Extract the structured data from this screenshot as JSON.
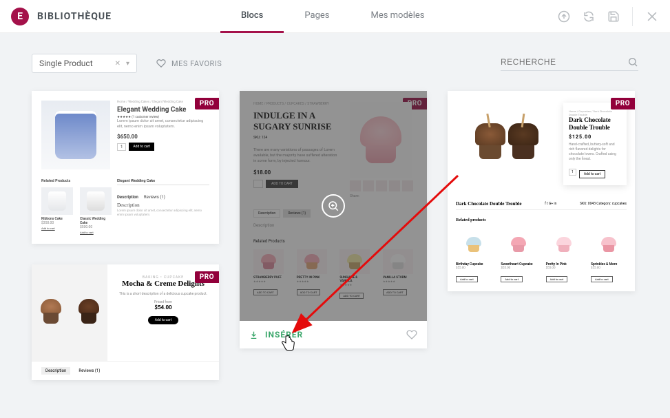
{
  "header": {
    "logo_glyph": "E",
    "title": "BIBLIOTHÈQUE",
    "tabs": {
      "blocs": "Blocs",
      "pages": "Pages",
      "models": "Mes modèles"
    }
  },
  "filter": {
    "select_value": "Single Product",
    "favorites": "MES FAVORIS",
    "search_placeholder": "RECHERCHE"
  },
  "badges": {
    "pro": "PRO"
  },
  "actions": {
    "insert": "INSÉRER"
  },
  "card1": {
    "crumb": "Home / Wedding Cakes / Elegant Wedding Cake",
    "title": "Elegant Wedding Cake",
    "rating_note": "★★★★★ (1 customer review)",
    "desc": "Lorem ipsum dolor sit amet, consectetur adipiscing elit, nemo enim ipsam voluptatem.",
    "price": "$650.00",
    "qty": "1",
    "add": "Add to cart",
    "related_h": "Related Products",
    "feat_title": "Elegant Wedding Cake",
    "r1": "Ribbons Cake",
    "r1p": "$350.00",
    "r2": "Classic Wedding Cake",
    "r2p": "$500.00",
    "rbtn": "Add to cart",
    "tab_desc": "Description",
    "tab_rev": "Reviews (1)",
    "desc_h": "Description"
  },
  "card_mocha": {
    "brand": "BAKING  •  CUPCAKE",
    "title": "Mocha & Creme Delights",
    "desc": "This is a short description of a delicious cupcake product.",
    "price_label": "Priced from",
    "price": "$54.00",
    "add": "Add to cart",
    "tab_desc": "Description",
    "tab_rev": "Reviews (1)"
  },
  "card2": {
    "crumb": "HOME / PRODUCTS / CUPCAKES / STRAWBERRY",
    "title": "INDULGE IN A SUGARY SUNRISE",
    "sku": "SKU: 124",
    "desc": "There are many variations of passages of Lorem available, but the majority have suffered alteration in some form, by injected humour.",
    "price": "$18.00",
    "add": "ADD TO CART",
    "share": "Share:",
    "tab_desc": "Description",
    "tab_rev": "Reviews (1)",
    "desc_h": "Description",
    "rel_h": "Related Products",
    "r1": "STRAWBERRY PUFF",
    "r2": "PRETTY IN PINK",
    "r3": "SUNSHINE & VANILLA",
    "r4": "VANILLA STORM",
    "rbtn": "ADD TO CART"
  },
  "card3": {
    "crumb": "Home / Cupcakes / Dark Chocolate Double Trouble",
    "title": "Dark Chocolate Double Trouble",
    "price": "$125.00",
    "desc": "Hand-crafted, buttery-soft and rich flavored delights for chocolate lovers. Crafted using only the finest.",
    "qty": "1",
    "add": "Add to cart",
    "mid_title": "Dark Chocolate Double Trouble",
    "mid_social": "f  t  G+  in",
    "mid_sku": "SKU: 0043   Category: cupcakes",
    "rel_h": "Related products",
    "r1": "Birthday Cupcake",
    "r1p": "$55.00",
    "r2": "Sweetheart Cupcake",
    "r2p": "$55.00",
    "r3": "Pretty In Pink",
    "r3p": "$55.00",
    "r4": "Sprinkles & More",
    "r4p": "$55.00",
    "rbtn": "Add to cart"
  }
}
